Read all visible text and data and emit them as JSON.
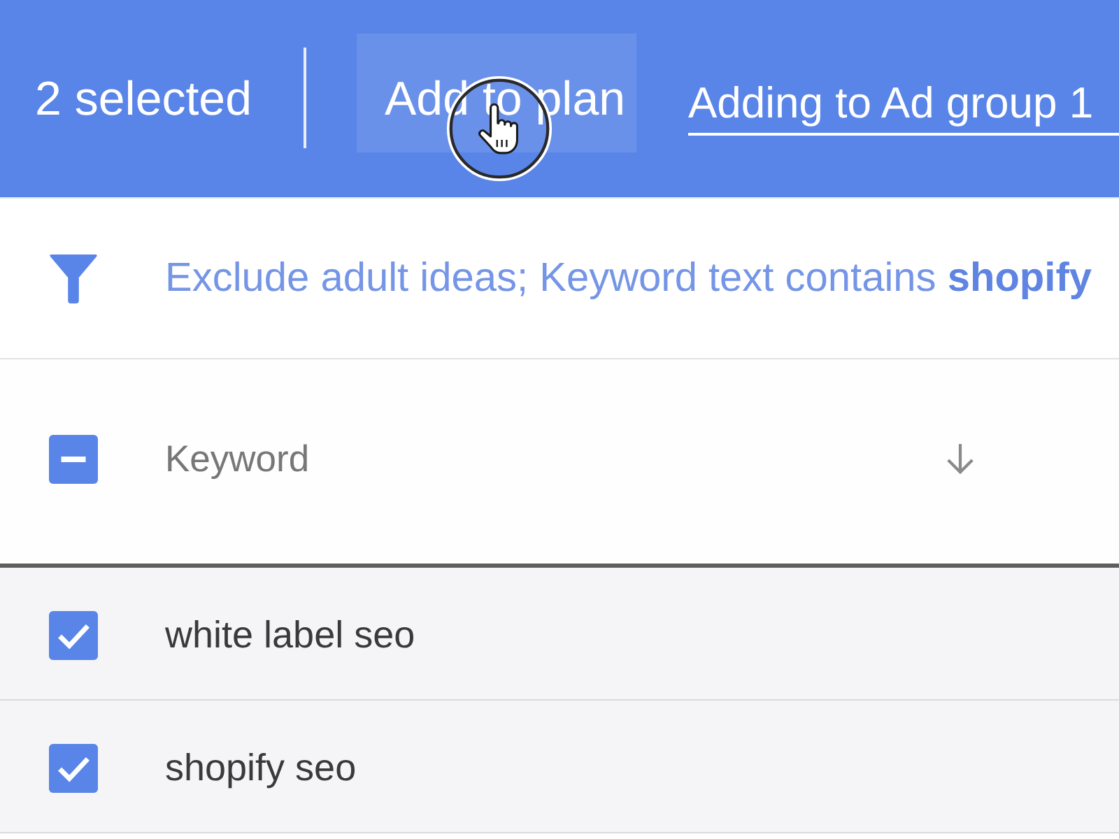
{
  "header_bar": {
    "selection_count": "2 selected",
    "add_button": {
      "label": "Add to plan",
      "hovered": true
    },
    "ad_group_selector": {
      "label": "Adding to Ad group 1"
    }
  },
  "filter_bar": {
    "summary": "Exclude adult ideas; Keyword text contains **shopify**"
  },
  "table": {
    "select_all": {
      "indeterminate": true
    },
    "columns": [
      {
        "label": "Keyword",
        "sort_descending": true
      }
    ],
    "rows": [
      {
        "checked": true,
        "cells": [
          "white label seo"
        ]
      },
      {
        "checked": true,
        "cells": [
          "shopify seo"
        ]
      }
    ]
  }
}
